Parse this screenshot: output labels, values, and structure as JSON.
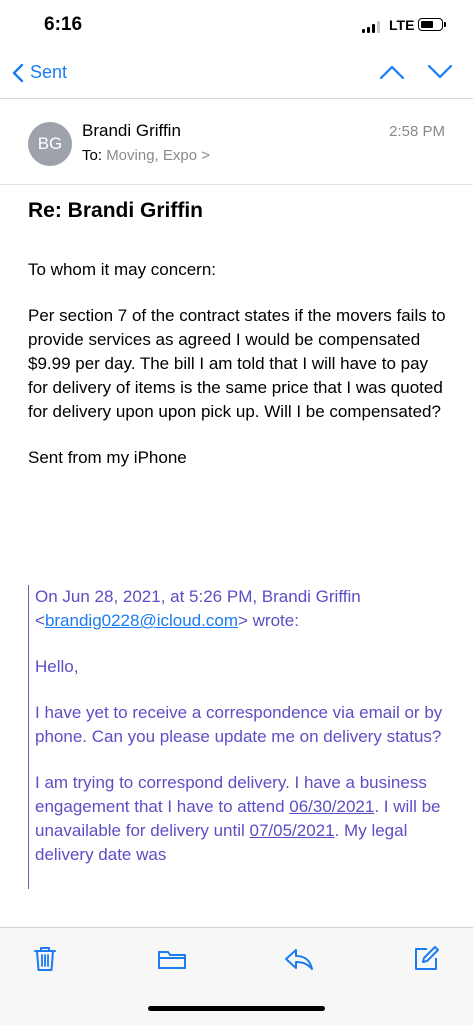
{
  "status": {
    "time": "6:16",
    "network": "LTE",
    "battery_level": 0.65
  },
  "nav": {
    "back_label": "Sent"
  },
  "sender": {
    "initials": "BG",
    "name": "Brandi Griffin",
    "to_prefix": "To:",
    "recipients": "Moving, Expo >",
    "time": "2:58 PM"
  },
  "email": {
    "subject": "Re: Brandi Griffin",
    "greeting": "To whom it may concern:",
    "paragraph": "Per section 7 of the contract states if the movers fails to provide services as agreed I would be compensated $9.99 per day. The bill I am told that I will have to pay for delivery of items is the same price that I was quoted for delivery upon upon pick up. Will I be compensated?",
    "signature": "Sent from my iPhone"
  },
  "quote": {
    "header_pre": "On Jun 28, 2021, at 5:26 PM, Brandi Griffin <",
    "email_link": "brandig0228@icloud.com",
    "header_post": "> wrote:",
    "hello": "Hello,",
    "p1": "I have yet to receive a correspondence via email or by phone. Can you please update me on delivery status?",
    "p2_pre": "I am trying to correspond delivery. I have a business engagement that I have to attend ",
    "p2_date1": "06/30/2021",
    "p2_mid": ". I will be unavailable for delivery until ",
    "p2_date2": "07/05/2021",
    "p2_post": ". My legal delivery date was"
  },
  "colors": {
    "accent": "#1b7cf2",
    "quote": "#5b4fc4",
    "avatar": "#9ea2ab"
  },
  "toolbar_icons": [
    "trash-icon",
    "folder-icon",
    "reply-icon",
    "compose-icon"
  ]
}
